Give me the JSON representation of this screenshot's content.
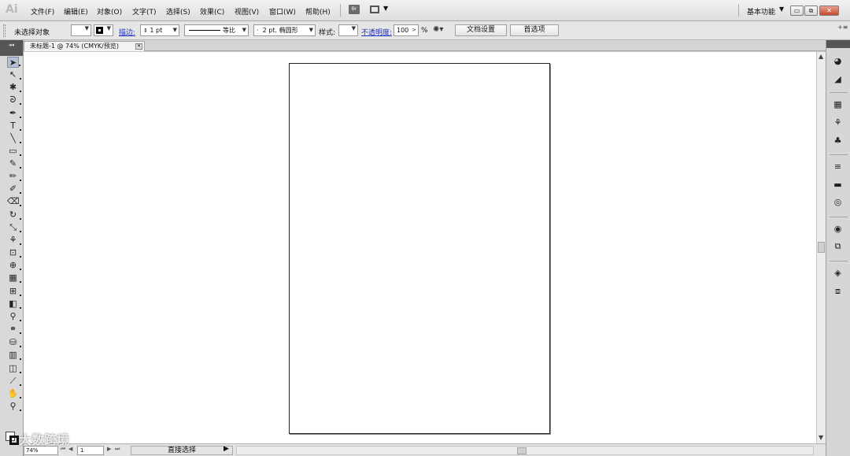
{
  "app": {
    "logo": "Ai"
  },
  "menu": [
    "文件(F)",
    "编辑(E)",
    "对象(O)",
    "文字(T)",
    "选择(S)",
    "效果(C)",
    "视图(V)",
    "窗口(W)",
    "帮助(H)"
  ],
  "bridge_label": "Br",
  "workspace": "基本功能",
  "window_buttons": {
    "minimize": "▭",
    "restore": "⧉",
    "close": "✕"
  },
  "control": {
    "selection": "未选择对象",
    "stroke_label": "描边:",
    "stroke_weight": "1 pt",
    "stroke_profile": "等比",
    "brush": "2 pt. 椭圆形",
    "brush_prefix": "·",
    "style_label": "样式:",
    "opacity_label": "不透明度:",
    "opacity_value": "100",
    "opacity_unit": "%",
    "doc_setup": "文档设置",
    "preferences": "首选项"
  },
  "document_tab": {
    "title": "未标题-1 @ 74% (CMYK/预览)",
    "close": "✕"
  },
  "status": {
    "zoom": "74%",
    "page": "1",
    "current_tool": "直接选择"
  },
  "watermark": "大数跨境",
  "tools": [
    {
      "name": "selection-tool-icon",
      "glyph": "➤"
    },
    {
      "name": "direct-selection-tool-icon",
      "glyph": "↖"
    },
    {
      "name": "magic-wand-tool-icon",
      "glyph": "✱"
    },
    {
      "name": "lasso-tool-icon",
      "glyph": "ᘐ"
    },
    {
      "name": "pen-tool-icon",
      "glyph": "✒"
    },
    {
      "name": "type-tool-icon",
      "glyph": "T"
    },
    {
      "name": "line-tool-icon",
      "glyph": "╲"
    },
    {
      "name": "rectangle-tool-icon",
      "glyph": "▭"
    },
    {
      "name": "paintbrush-tool-icon",
      "glyph": "✎"
    },
    {
      "name": "pencil-tool-icon",
      "glyph": "✏"
    },
    {
      "name": "blob-brush-tool-icon",
      "glyph": "✐"
    },
    {
      "name": "eraser-tool-icon",
      "glyph": "⌫"
    },
    {
      "name": "rotate-tool-icon",
      "glyph": "↻"
    },
    {
      "name": "scale-tool-icon",
      "glyph": "⤡"
    },
    {
      "name": "warp-tool-icon",
      "glyph": "⚘"
    },
    {
      "name": "free-transform-tool-icon",
      "glyph": "⊡"
    },
    {
      "name": "shape-builder-tool-icon",
      "glyph": "⊕"
    },
    {
      "name": "perspective-grid-tool-icon",
      "glyph": "▦"
    },
    {
      "name": "mesh-tool-icon",
      "glyph": "⊞"
    },
    {
      "name": "gradient-tool-icon",
      "glyph": "◧"
    },
    {
      "name": "eyedropper-tool-icon",
      "glyph": "⚲"
    },
    {
      "name": "blend-tool-icon",
      "glyph": "⚭"
    },
    {
      "name": "symbol-sprayer-tool-icon",
      "glyph": "⛁"
    },
    {
      "name": "column-graph-tool-icon",
      "glyph": "▥"
    },
    {
      "name": "artboard-tool-icon",
      "glyph": "◫"
    },
    {
      "name": "slice-tool-icon",
      "glyph": "⟋"
    },
    {
      "name": "hand-tool-icon",
      "glyph": "✋"
    },
    {
      "name": "zoom-tool-icon",
      "glyph": "⚲"
    }
  ],
  "right_panel": [
    {
      "name": "color-panel-icon",
      "glyph": "◕"
    },
    {
      "name": "color-guide-panel-icon",
      "glyph": "◢"
    },
    {
      "name": "swatches-panel-icon",
      "glyph": "▦"
    },
    {
      "name": "brushes-panel-icon",
      "glyph": "⚘"
    },
    {
      "name": "symbols-panel-icon",
      "glyph": "♣"
    },
    {
      "name": "stroke-panel-icon",
      "glyph": "≡"
    },
    {
      "name": "gradient-panel-icon",
      "glyph": "▬"
    },
    {
      "name": "transparency-panel-icon",
      "glyph": "◎"
    },
    {
      "name": "appearance-panel-icon",
      "glyph": "◉"
    },
    {
      "name": "graphic-styles-panel-icon",
      "glyph": "⧉"
    },
    {
      "name": "layers-panel-icon",
      "glyph": "◈"
    },
    {
      "name": "artboards-panel-icon",
      "glyph": "⧈"
    }
  ]
}
